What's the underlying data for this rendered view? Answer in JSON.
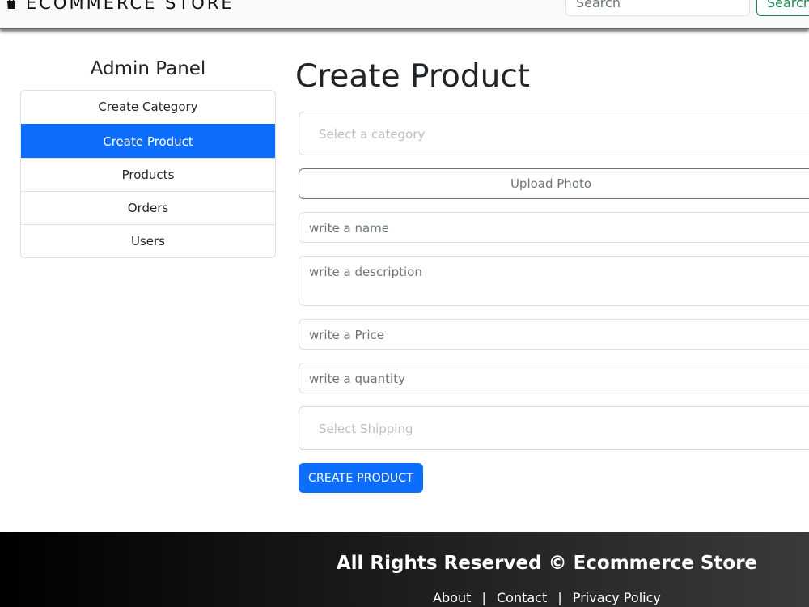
{
  "navbar": {
    "brand": "ECOMMERCE STORE",
    "search_placeholder": "Search",
    "search_button": "Search"
  },
  "sidebar": {
    "title": "Admin Panel",
    "items": [
      {
        "label": "Create Category"
      },
      {
        "label": "Create Product"
      },
      {
        "label": "Products"
      },
      {
        "label": "Orders"
      },
      {
        "label": "Users"
      }
    ],
    "active_index": 1
  },
  "main": {
    "title": "Create Product",
    "category_placeholder": "Select a category",
    "upload_label": "Upload Photo",
    "name_placeholder": "write a name",
    "description_placeholder": "write a description",
    "price_placeholder": "write a Price",
    "quantity_placeholder": "write a quantity",
    "shipping_placeholder": "Select Shipping",
    "submit_label": "CREATE PRODUCT"
  },
  "footer": {
    "text": "All Rights Reserved © Ecommerce Store",
    "links": [
      "About",
      "Contact",
      "Privacy Policy"
    ],
    "separator": "|"
  },
  "colors": {
    "primary": "#0d6efd",
    "success": "#198754",
    "footer_gradient_start": "#000000",
    "footer_gradient_end": "#3a3a3a"
  },
  "icons": {
    "brand": "shopping-bag-icon"
  }
}
